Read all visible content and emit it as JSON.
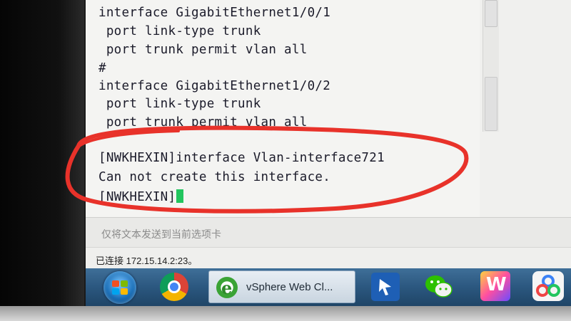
{
  "terminal": {
    "lines": [
      "interface GigabitEthernet1/0/1",
      " port link-type trunk",
      " port trunk permit vlan all",
      "#",
      "interface GigabitEthernet1/0/2",
      " port link-type trunk",
      " port trunk permit vlan all",
      "[NWKHEXIN]interface Vlan-interface721",
      "Can not create this interface.",
      "[NWKHEXIN]"
    ]
  },
  "send_bar": {
    "placeholder": "仅将文本发送到当前选项卡"
  },
  "status_bar": {
    "text": "已连接 172.15.14.2:23。"
  },
  "taskbar": {
    "start": "start-orb",
    "items": [
      {
        "icon": "chrome-icon",
        "label": ""
      },
      {
        "icon": "ie-icon",
        "label": "vSphere Web Cl..."
      },
      {
        "icon": "vsphere-client-icon",
        "label": ""
      },
      {
        "icon": "wechat-icon",
        "label": ""
      },
      {
        "icon": "w-app-icon",
        "label": "W"
      },
      {
        "icon": "share-icon",
        "label": ""
      }
    ]
  },
  "colors": {
    "annotation": "#e8322a",
    "cursor": "#22c55e",
    "taskbar": "#2b577f"
  }
}
